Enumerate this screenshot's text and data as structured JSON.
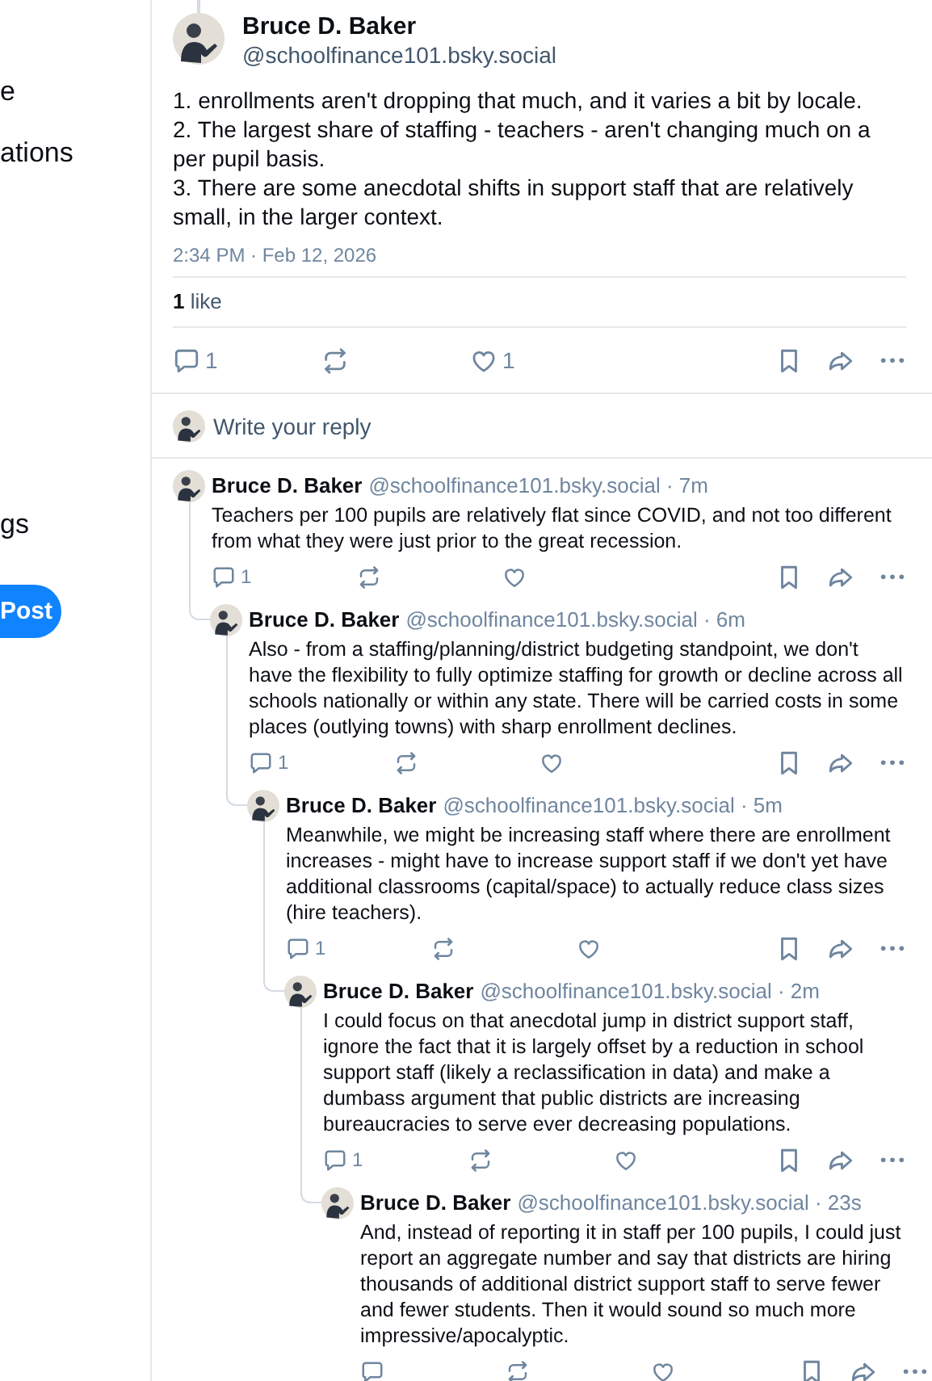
{
  "sidebar": {
    "items": [
      {
        "label": "e"
      },
      {
        "label": "ations"
      },
      {
        "label": "gs"
      }
    ],
    "post_button": "Post"
  },
  "post": {
    "author": "Bruce D. Baker",
    "handle": "@schoolfinance101.bsky.social",
    "paragraphs": [
      "1. enrollments aren't dropping that much, and it varies a bit by locale.",
      "2. The largest share of staffing - teachers - aren't changing much on a per pupil basis.",
      "3. There are some anecdotal shifts in support staff that are relatively small, in the larger context."
    ],
    "timestamp": "2:34 PM · Feb 12, 2026",
    "likes_summary": "**1** like",
    "reply_count": "1",
    "like_count": "1"
  },
  "reply_box": {
    "placeholder": "Write your reply"
  },
  "replies": [
    {
      "author": "Bruce D. Baker",
      "meta": "@schoolfinance101.bsky.social · 7m",
      "text": "Teachers per 100 pupils are relatively flat since COVID, and not too different from what they were just prior to the great recession.",
      "reply_count": "1",
      "children": [
        {
          "author": "Bruce D. Baker",
          "meta": "@schoolfinance101.bsky.social · 6m",
          "text": "Also - from a staffing/planning/district budgeting standpoint, we don't have the flexibility to fully optimize staffing for growth or decline across all schools nationally or within any state. There will be carried costs in some places (outlying towns) with sharp enrollment declines.",
          "reply_count": "1",
          "children": [
            {
              "author": "Bruce D. Baker",
              "meta": "@schoolfinance101.bsky.social · 5m",
              "text": "Meanwhile, we might be increasing staff where there are enrollment increases - might have to increase support staff if we don't yet have additional classrooms (capital/space) to actually reduce class sizes (hire teachers).",
              "reply_count": "1",
              "children": [
                {
                  "author": "Bruce D. Baker",
                  "meta": "@schoolfinance101.bsky.social · 2m",
                  "text": "I could focus on that anecdotal jump in district support staff, ignore the fact that it is largely offset by a reduction in school support staff (likely a reclassification in data) and make a dumbass argument that public districts are increasing bureaucracies to serve ever decreasing populations.",
                  "reply_count": "1",
                  "children": [
                    {
                      "author": "Bruce D. Baker",
                      "meta": "@schoolfinance101.bsky.social · 23s",
                      "text": "And, instead of reporting it in staff per 100 pupils, I could just report an aggregate number and say that districts are hiring thousands of additional district support staff to serve fewer and fewer students. Then it would sound so much more impressive/apocalyptic."
                    }
                  ]
                }
              ]
            }
          ]
        }
      ]
    }
  ]
}
